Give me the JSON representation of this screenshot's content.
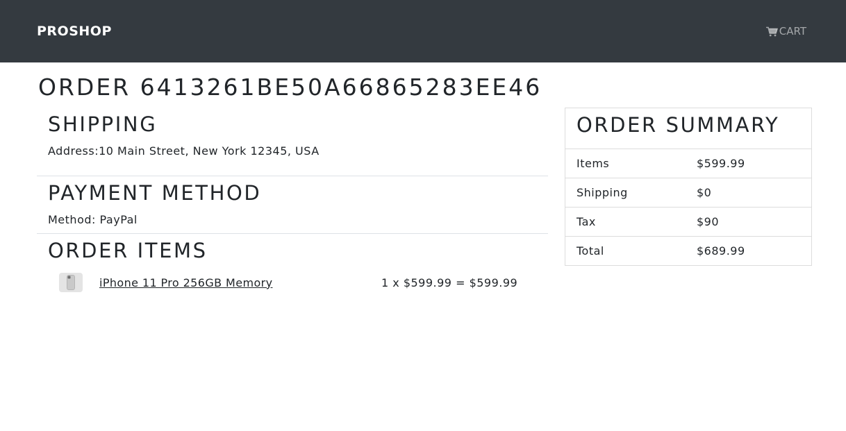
{
  "navbar": {
    "brand": "PROSHOP",
    "cart_label": "CART",
    "cart_icon": "cart-icon"
  },
  "order": {
    "title": "ORDER 6413261BE50A66865283EE46"
  },
  "shipping": {
    "heading": "SHIPPING",
    "address": "Address:10 Main Street, New York 12345, USA"
  },
  "payment": {
    "heading": "PAYMENT METHOD",
    "method": "Method: PayPal"
  },
  "order_items": {
    "heading": "ORDER ITEMS",
    "items": [
      {
        "name": "iPhone 11 Pro 256GB Memory",
        "price_line": "1 x $599.99 = $599.99"
      }
    ]
  },
  "summary": {
    "heading": "ORDER SUMMARY",
    "rows": [
      {
        "label": "Items",
        "value": "$599.99"
      },
      {
        "label": "Shipping",
        "value": "$0"
      },
      {
        "label": "Tax",
        "value": "$90"
      },
      {
        "label": "Total",
        "value": "$689.99"
      }
    ]
  },
  "colors": {
    "navbar_bg": "#343a40",
    "text": "#212529",
    "border": "#dee2e6"
  }
}
